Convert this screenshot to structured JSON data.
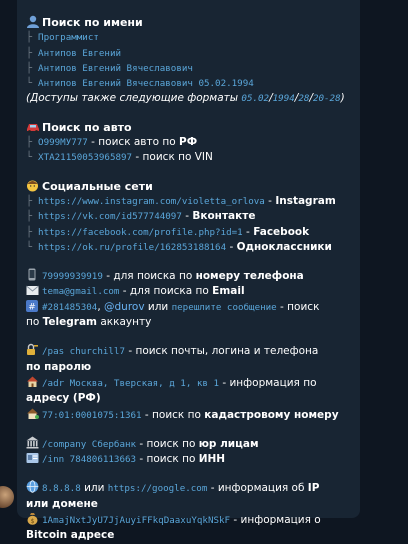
{
  "top_partial": "… …",
  "name_section": {
    "heading": "Поиск по имени",
    "items": [
      "Программист",
      "Антипов Евгений",
      "Антипов Евгений Вячеславович",
      "Антипов Евгений Вячеславович 05.02.1994"
    ],
    "formats_prefix": "(Доступы также следующие форматы ",
    "formats": [
      "05.02",
      "1994",
      "28",
      "20-28"
    ],
    "formats_suffix": ")"
  },
  "auto_section": {
    "heading": "Поиск по авто",
    "plate": "О999МУ777",
    "plate_text": " - поиск авто по ",
    "plate_bold": "РФ",
    "vin": "XTA21150053965897",
    "vin_text": " - поиск по VIN"
  },
  "social_section": {
    "heading": "Социальные сети",
    "items": [
      {
        "url": "https://www.instagram.com/violetta_orlova",
        "sep": " - ",
        "label": "Instagram"
      },
      {
        "url": "https://vk.com/id577744097",
        "sep": " - ",
        "label": "Вконтакте"
      },
      {
        "url": "https://facebook.com/profile.php?id=1",
        "sep": " - ",
        "label": "Facebook"
      },
      {
        "url": "https://ok.ru/profile/162853188164",
        "sep": " - ",
        "label": "Одноклассники"
      }
    ]
  },
  "phone_section": {
    "phone": "79999939919",
    "phone_text": " - для поиска по ",
    "phone_bold": "номеру телефона",
    "email": "tema@gmail.com",
    "email_text": " - для поиска по ",
    "email_bold": "Email",
    "tg_id": "#281485304",
    "tg_sep": ", ",
    "tg_user": "@durov",
    "tg_or": " или ",
    "tg_forward": "перешлите сообщение",
    "tg_text": " - поиск по ",
    "tg_bold": "Telegram",
    "tg_tail": " аккаунту"
  },
  "commands_section": {
    "pas_cmd": "/pas churchill7",
    "pas_text": " - поиск почты, логина и телефона ",
    "pas_bold": "по паролю",
    "adr_cmd": "/adr Москва, Тверская, д 1, кв 1",
    "adr_text": " - информация по ",
    "adr_bold": "адресу (РФ)",
    "cad_cmd": "77:01:0001075:1361",
    "cad_text": " - поиск по ",
    "cad_bold": "кадастровому номеру"
  },
  "company_section": {
    "company_cmd": "/company Сбербанк",
    "company_text": " - поиск по ",
    "company_bold": "юр лицам",
    "inn_cmd": "/inn 784806113663",
    "inn_text": " - поиск по ",
    "inn_bold": "ИНН"
  },
  "net_section": {
    "ip": "8.8.8.8",
    "ip_or": " или ",
    "domain": "https://google.com",
    "ip_text": " - информация об ",
    "ip_bold": "IP или домене",
    "btc": "1AmajNxtJyU7JjAuyiFFkqDaaxuYqkNSkF",
    "btc_text": " - информация о ",
    "btc_bold": "Bitcoin адресе"
  },
  "icons": {
    "person": "person-silhouette-icon",
    "car": "red-car-icon",
    "social": "face-icon",
    "phone": "phone-icon",
    "mail": "envelope-icon",
    "hash": "hash-icon",
    "lock": "lock-key-icon",
    "house": "house-icon",
    "cadastre": "house-with-garden-icon",
    "bank": "bank-building-icon",
    "id": "id-card-icon",
    "globe": "globe-icon",
    "btc": "money-bag-icon"
  },
  "colors": {
    "background": "#0e1621",
    "bubble": "#182533",
    "link": "#6ab2f2",
    "mono": "#5aa6d9",
    "tree": "#6c7883"
  }
}
